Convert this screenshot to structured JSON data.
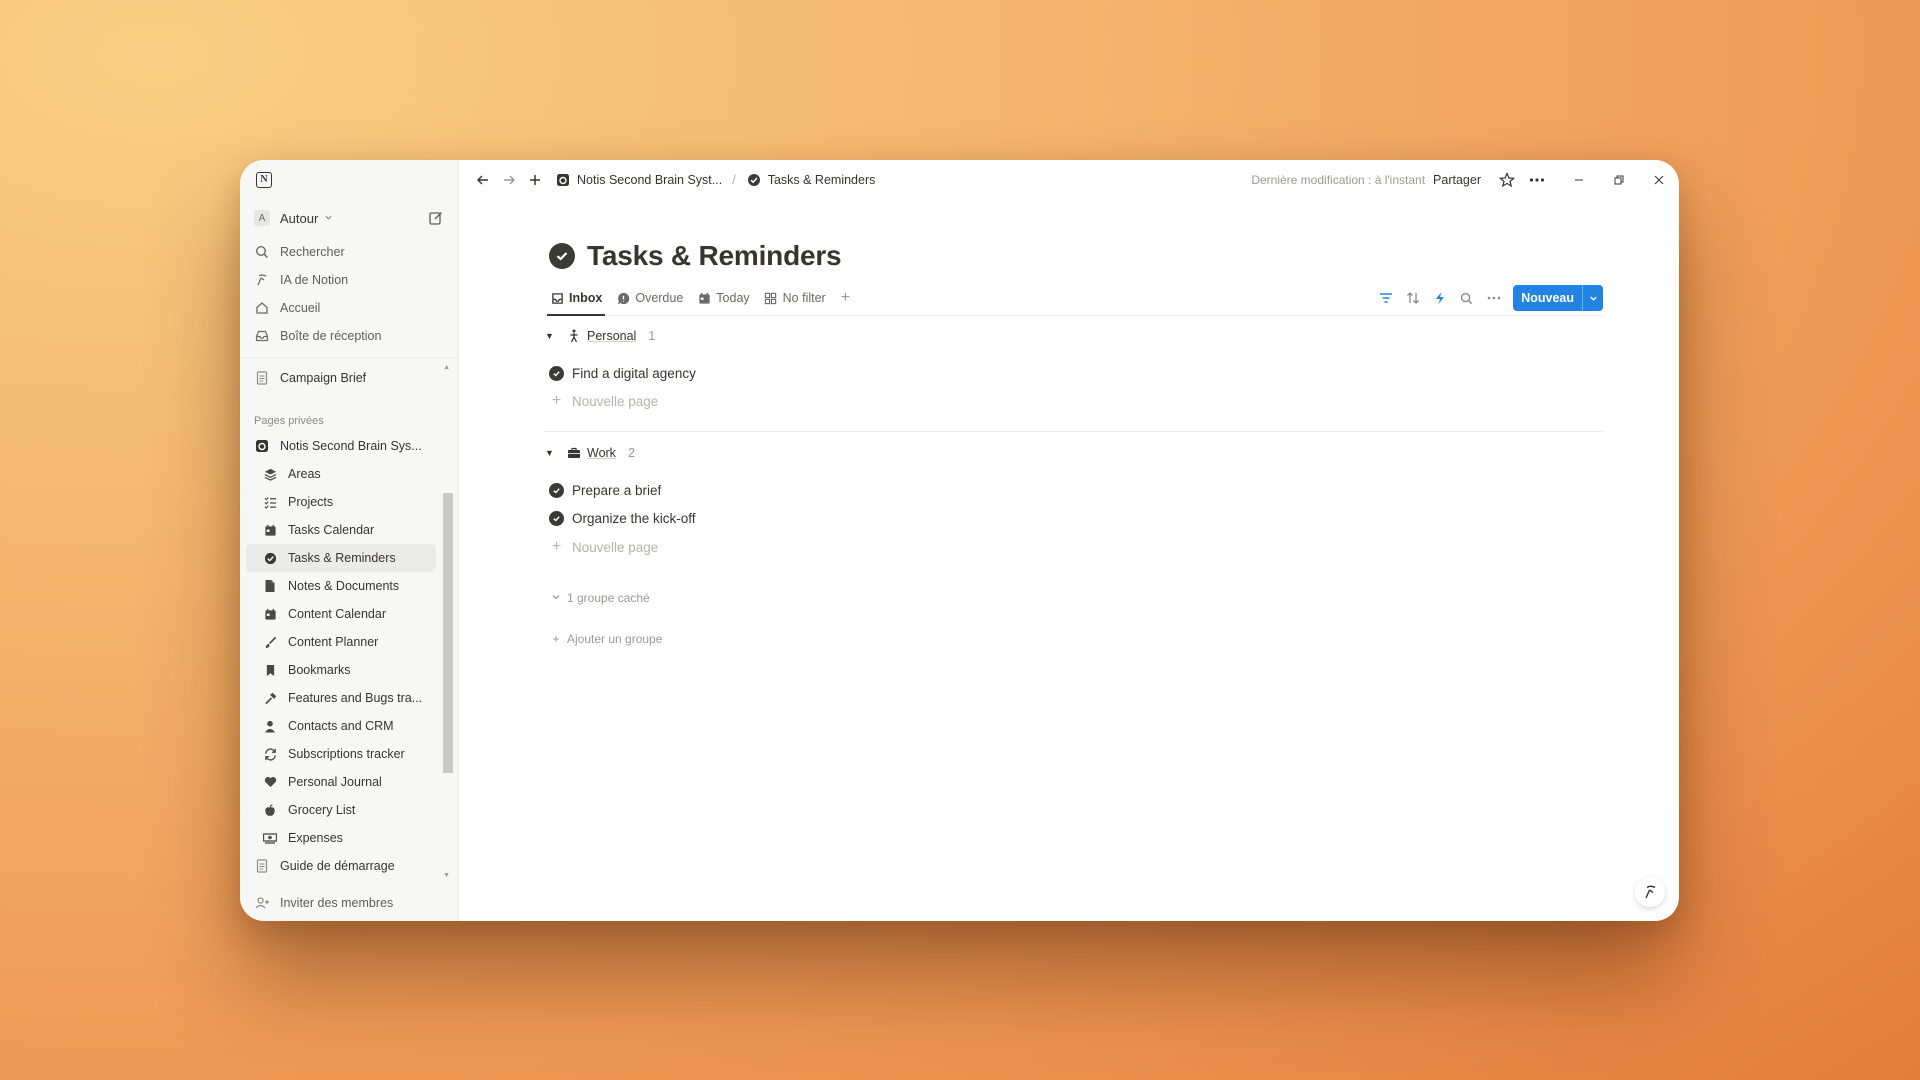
{
  "workspace": {
    "avatar": "A",
    "name": "Autour"
  },
  "sidebar": {
    "nav": [
      {
        "label": "Rechercher",
        "icon": "search-icon"
      },
      {
        "label": "IA de Notion",
        "icon": "notion-ai-icon"
      },
      {
        "label": "Accueil",
        "icon": "home-icon"
      },
      {
        "label": "Boîte de réception",
        "icon": "inbox-icon"
      }
    ],
    "recent": {
      "label": "Campaign Brief",
      "icon": "document-icon"
    },
    "section_label": "Pages privées",
    "root": {
      "label": "Notis Second Brain Sys...",
      "icon": "notion-logo-icon"
    },
    "pages": [
      {
        "label": "Areas",
        "icon": "layers-icon"
      },
      {
        "label": "Projects",
        "icon": "checklist-icon"
      },
      {
        "label": "Tasks Calendar",
        "icon": "calendar-icon"
      },
      {
        "label": "Tasks & Reminders",
        "icon": "check-circle-icon",
        "active": true
      },
      {
        "label": "Notes & Documents",
        "icon": "document-icon"
      },
      {
        "label": "Content Calendar",
        "icon": "calendar-icon"
      },
      {
        "label": "Content Planner",
        "icon": "brush-icon"
      },
      {
        "label": "Bookmarks",
        "icon": "bookmark-icon"
      },
      {
        "label": "Features and Bugs tra...",
        "icon": "hammer-icon"
      },
      {
        "label": "Contacts and CRM",
        "icon": "person-icon"
      },
      {
        "label": "Subscriptions tracker",
        "icon": "refresh-icon"
      },
      {
        "label": "Personal Journal",
        "icon": "heart-icon"
      },
      {
        "label": "Grocery List",
        "icon": "apple-icon"
      },
      {
        "label": "Expenses",
        "icon": "money-icon"
      }
    ],
    "guide": {
      "label": "Guide de démarrage",
      "icon": "document-icon"
    },
    "invite": {
      "label": "Inviter des membres",
      "icon": "add-person-icon"
    }
  },
  "topbar": {
    "breadcrumb": [
      {
        "label": "Notis Second Brain Syst...",
        "icon": "notion-logo-icon"
      },
      {
        "label": "Tasks & Reminders",
        "icon": "check-circle-icon"
      }
    ],
    "last_edit": "Dernière modification : à l'instant",
    "share": "Partager"
  },
  "page": {
    "title": "Tasks & Reminders",
    "tabs": [
      {
        "label": "Inbox",
        "icon": "inbox-icon",
        "active": true
      },
      {
        "label": "Overdue",
        "icon": "alert-icon"
      },
      {
        "label": "Today",
        "icon": "calendar-icon"
      },
      {
        "label": "No filter",
        "icon": "grid-icon"
      }
    ],
    "new_button": "Nouveau",
    "groups": [
      {
        "name": "Personal",
        "count": "1",
        "icon": "person-walking-icon",
        "tasks": [
          "Find a digital agency"
        ]
      },
      {
        "name": "Work",
        "count": "2",
        "icon": "briefcase-icon",
        "tasks": [
          "Prepare a brief",
          "Organize the kick-off"
        ]
      }
    ],
    "new_page_label": "Nouvelle page",
    "hidden_groups": "1 groupe caché",
    "add_group": "Ajouter un groupe"
  },
  "colors": {
    "accent": "#2383e2",
    "sidebar_bg": "#f7f7f5",
    "text": "#37352f"
  }
}
